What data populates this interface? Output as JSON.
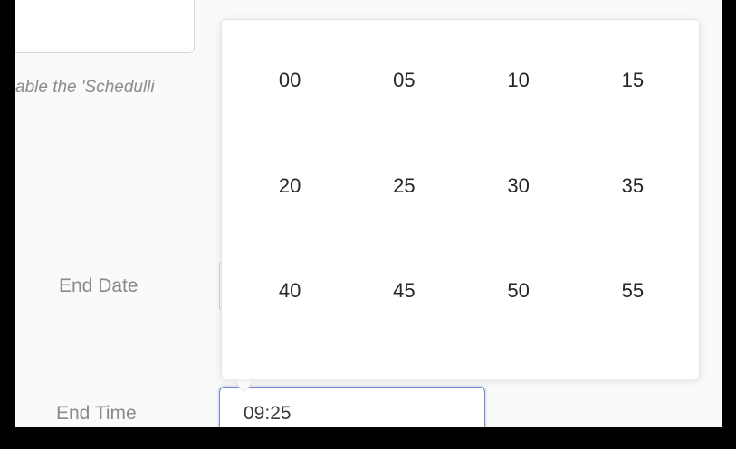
{
  "form": {
    "hint_text": "able the 'Schedulli",
    "end_date_label": "End Date",
    "end_time_label": "End Time",
    "end_time_value": "09:25"
  },
  "picker": {
    "minutes": [
      "00",
      "05",
      "10",
      "15",
      "20",
      "25",
      "30",
      "35",
      "40",
      "45",
      "50",
      "55"
    ]
  },
  "colors": {
    "accent": "#6f87cf",
    "label": "#8a8a8a",
    "background": "#fafaf9"
  }
}
